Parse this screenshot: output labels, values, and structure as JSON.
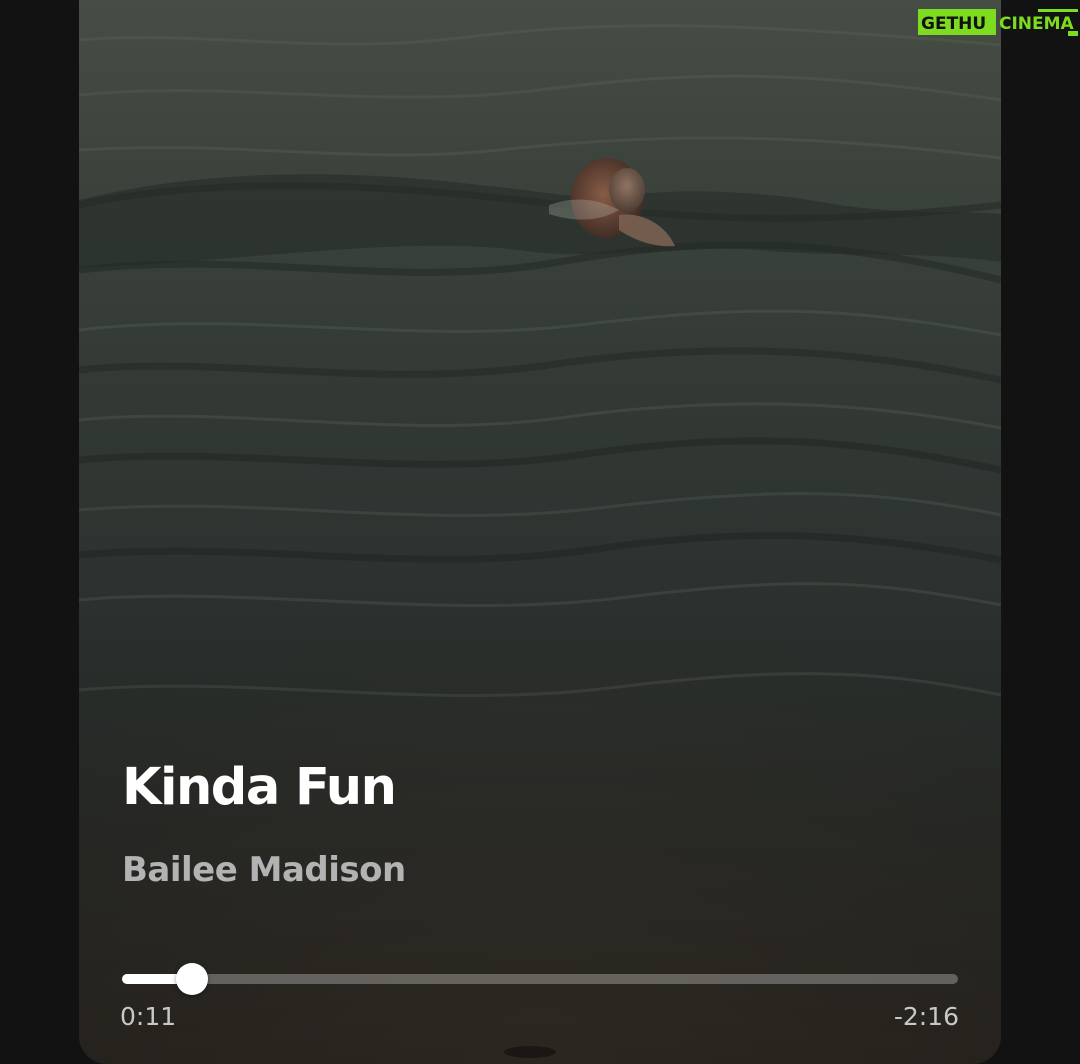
{
  "track": {
    "title": "Kinda Fun",
    "artist": "Bailee Madison"
  },
  "playback": {
    "elapsed_text": "0:11",
    "remaining_text": "-2:16",
    "progress_fraction": 0.0839
  },
  "watermark": {
    "text": "GETHUCINEMA"
  },
  "colors": {
    "background": "#121212",
    "title": "#ffffff",
    "artist": "#b3b3b3",
    "progress_fill": "#ffffff",
    "watermark_green": "#7ddc1f"
  },
  "icons": {
    "thumb": "seek-thumb"
  }
}
